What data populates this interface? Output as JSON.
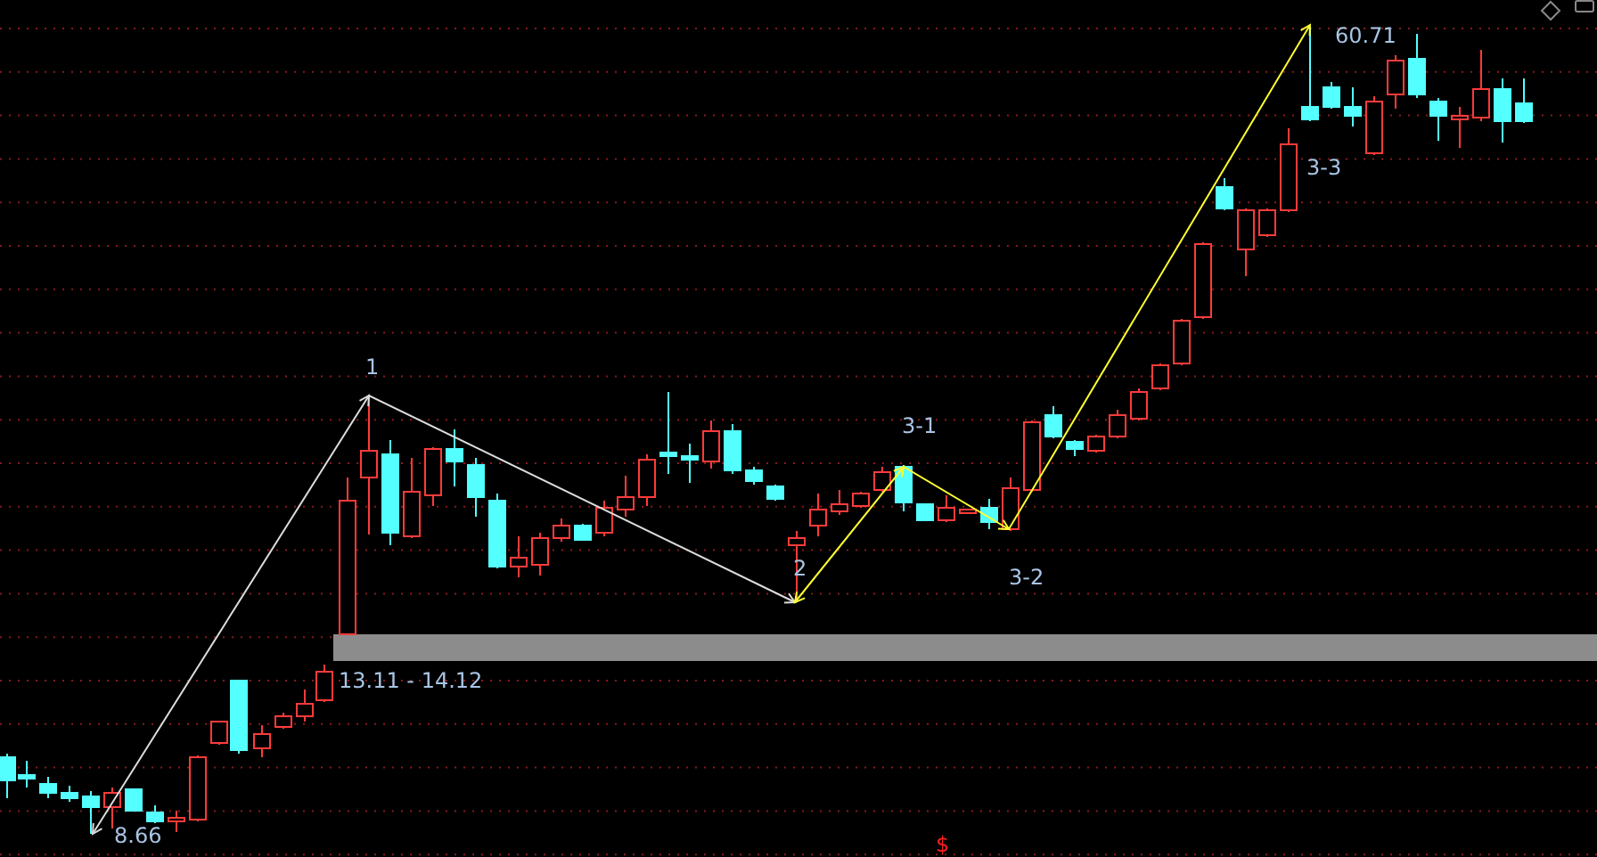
{
  "chart": {
    "wave_labels": [
      "1",
      "2",
      "3-1",
      "3-2",
      "3-3"
    ],
    "high_label": "60.71",
    "low_label": "8.66",
    "zone_label": "13.11 - 14.12",
    "marker": "$"
  }
}
